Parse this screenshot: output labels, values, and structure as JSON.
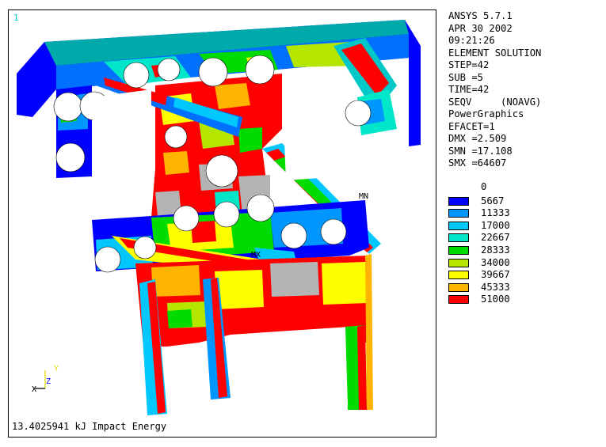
{
  "viewport": {
    "window_number": "1",
    "caption": "13.4025941 kJ Impact Energy",
    "markers": {
      "mn": "MN",
      "mx": "MX"
    },
    "triad": {
      "x": "X",
      "y": "Y",
      "z": "Z"
    }
  },
  "info": {
    "lines": [
      "ANSYS 5.7.1",
      "APR 30 2002",
      "09:21:26",
      "ELEMENT SOLUTION",
      "STEP=42",
      "SUB =5",
      "TIME=42",
      "SEQV     (NOAVG)",
      "PowerGraphics",
      "EFACET=1",
      "DMX =2.509",
      "SMN =17.108",
      "SMX =64607"
    ]
  },
  "legend": {
    "first_label": "0",
    "entries": [
      {
        "label": "5667",
        "color": "#0000ff"
      },
      {
        "label": "11333",
        "color": "#0096ff"
      },
      {
        "label": "17000",
        "color": "#00c8ff"
      },
      {
        "label": "22667",
        "color": "#00e6c8"
      },
      {
        "label": "28333",
        "color": "#00dc00"
      },
      {
        "label": "34000",
        "color": "#b4e600"
      },
      {
        "label": "39667",
        "color": "#ffff00"
      },
      {
        "label": "45333",
        "color": "#ffb400"
      },
      {
        "label": "51000",
        "color": "#ff0000"
      }
    ],
    "overflow_color": "#b4b4b4"
  }
}
